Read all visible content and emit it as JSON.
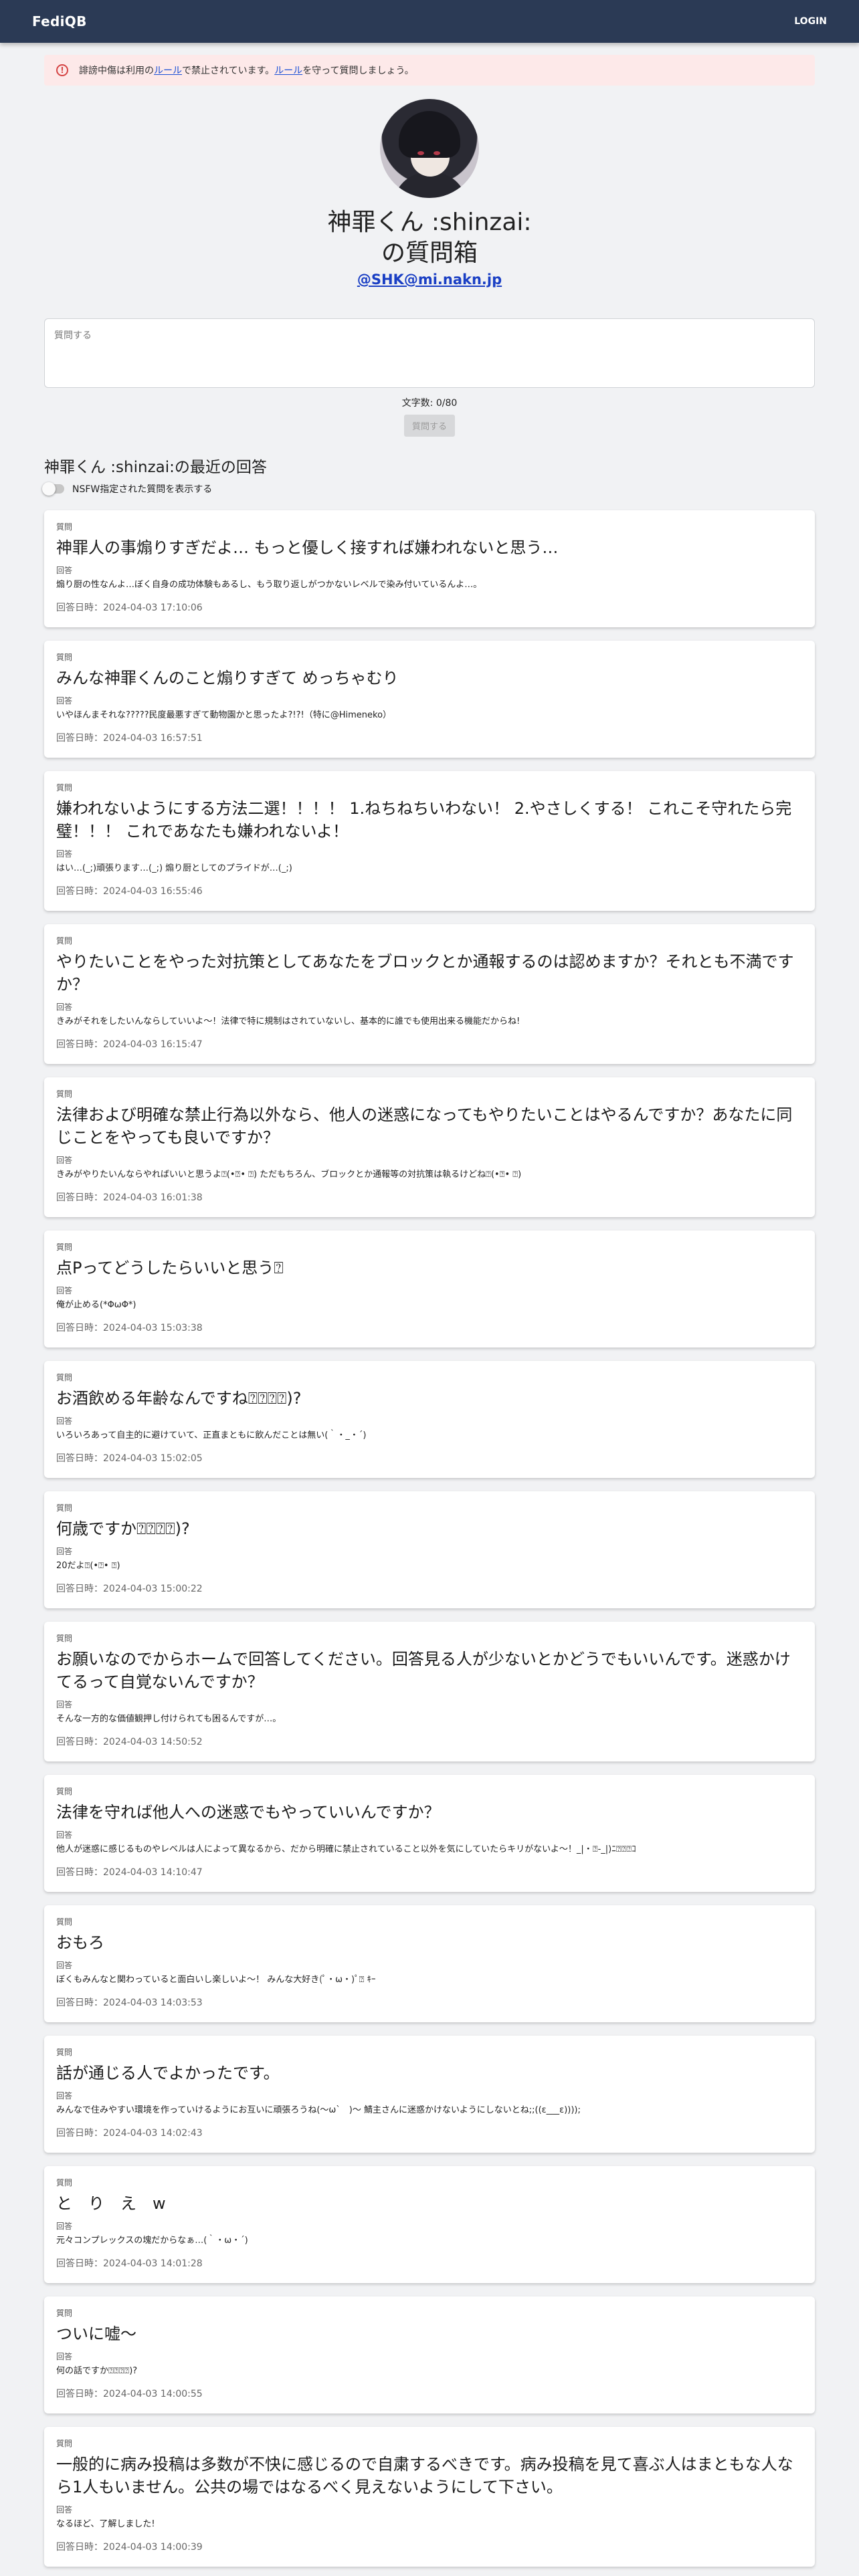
{
  "navbar": {
    "brand": "FediQB",
    "login": "LOGIN"
  },
  "alert": {
    "text_1": "誹謗中傷は利用の",
    "link_1": "ルール",
    "text_2": "で禁止されています。",
    "link_2": "ルール",
    "text_3": "を守って質問しましょう。"
  },
  "profile": {
    "title_line1": "神罪くん :shinzai:",
    "title_line2": "の質問箱",
    "handle": "@SHK@mi.nakn.jp"
  },
  "ask": {
    "placeholder": "質問する",
    "counter": "文字数: 0/80",
    "button": "質問する"
  },
  "recent": {
    "title": "神罪くん :shinzai:の最近の回答",
    "nsfw_label": "NSFW指定された質問を表示する"
  },
  "labels": {
    "question": "質問",
    "answer": "回答"
  },
  "items": [
    {
      "q": "神罪人の事煽りすぎだよ… もっと優しく接すれば嫌われないと思う…",
      "a": "煽り厨の性なんよ…ぼく自身の成功体験もあるし、もう取り返しがつかないレベルで染み付いているんよ…。",
      "t": "回答日時：2024-04-03 17:10:06"
    },
    {
      "q": "みんな神罪くんのこと煽りすぎて めっちゃむり",
      "a": "いやほんまそれな?????民度最悪すぎて動物園かと思ったよ?!?!（特に@Himeneko）",
      "t": "回答日時：2024-04-03 16:57:51"
    },
    {
      "q": "嫌われないようにする方法二選！！！！ 1.ねちねちいわない！ 2.やさしくする！ これこそ守れたら完璧！！！ これであなたも嫌われないよ！",
      "a": "はい…(_;)頑張ります…(_;) 煽り厨としてのプライドが…(_;)",
      "t": "回答日時：2024-04-03 16:55:46"
    },
    {
      "q": "やりたいことをやった対抗策としてあなたをブロックとか通報するのは認めますか？それとも不満ですか？",
      "a": "きみがそれをしたいんならしていいよ〜！法律で特に規制はされていないし、基本的に誰でも使用出来る機能だからね!",
      "t": "回答日時：2024-04-03 16:15:47"
    },
    {
      "q": "法律および明確な禁止行為以外なら、他人の迷惑になってもやりたいことはやるんですか？あなたに同じことをやっても良いですか？",
      "a": "きみがやりたいんならやればいいと思うよ⍰(•⍰• ⍰) ただもちろん、ブロックとか通報等の対抗策は執るけどね⍰(•⍰• ⍰)",
      "t": "回答日時：2024-04-03 16:01:38"
    },
    {
      "q": "点Pってどうしたらいいと思う⍰",
      "a": "俺が止める(*ΦωΦ*)",
      "t": "回答日時：2024-04-03 15:03:38"
    },
    {
      "q": "お酒飲める年齢なんですね⍰⍰⍰⍰)?",
      "a": "いろいろあって自主的に避けていて、正直まともに飲んだことは無い(｀・_・´)",
      "t": "回答日時：2024-04-03 15:02:05"
    },
    {
      "q": "何歳ですか⍰⍰⍰⍰)?",
      "a": "20だよ⍰(•⍰• ⍰)",
      "t": "回答日時：2024-04-03 15:00:22"
    },
    {
      "q": "お願いなのでからホームで回答してください。回答見る人が少ないとかどうでもいいんです。迷惑かけてるって自覚ないんですか？",
      "a": "そんな一方的な価値観押し付けられても困るんですが…。",
      "t": "回答日時：2024-04-03 14:50:52"
    },
    {
      "q": "法律を守れば他人への迷惑でもやっていいんですか？",
      "a": "他人が迷惑に感じるものやレベルは人によって異なるから、だから明確に禁止されていること以外を気にしていたらキリがないよ〜！_|・⍰-_|)ﾆ⍰⍰⍰ｺ",
      "t": "回答日時：2024-04-03 14:10:47"
    },
    {
      "q": "おもろ",
      "a": "ぼくもみんなと関わっていると面白いし楽しいよ〜！ みんな大好き(ﾟ・ω・)ﾟ⍰ ｷｰ",
      "t": "回答日時：2024-04-03 14:03:53"
    },
    {
      "q": "話が通じる人でよかったです。",
      "a": "みんなで住みやすい環境を作っていけるようにお互いに頑張ろうね(〜ω`　)〜 鯖主さんに迷惑かけないようにしないとね;;((ε___ε))));",
      "t": "回答日時：2024-04-03 14:02:43"
    },
    {
      "q": "と　り　え　w",
      "a": "元々コンプレックスの塊だからなぁ…(｀・ω・´)",
      "t": "回答日時：2024-04-03 14:01:28"
    },
    {
      "q": "ついに嘘〜",
      "a": "何の話ですか⍰⍰⍰⍰)?",
      "t": "回答日時：2024-04-03 14:00:55"
    },
    {
      "q": "一般的に病み投稿は多数が不快に感じるので自粛するべきです。病み投稿を見て喜ぶ人はまともな人なら1人もいません。公共の場ではなるべく見えないようにして下さい。",
      "a": "なるほど、了解しました!",
      "t": "回答日時：2024-04-03 14:00:39"
    }
  ]
}
